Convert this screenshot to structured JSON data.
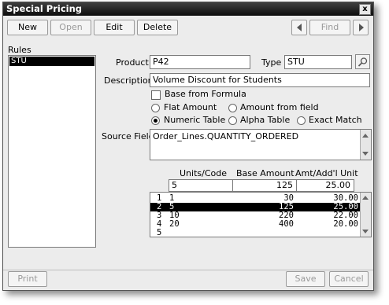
{
  "window": {
    "title": "Special Pricing",
    "close_glyph": "x"
  },
  "toolbar": {
    "new_label": "New",
    "open_label": "Open",
    "edit_label": "Edit",
    "delete_label": "Delete",
    "find_label": "Find",
    "prev_icon": "left-arrow-icon",
    "next_icon": "right-arrow-icon"
  },
  "rules": {
    "label": "Rules",
    "items": [
      "STU"
    ]
  },
  "form": {
    "product_label": "Product",
    "product_value": "P42",
    "type_label": "Type",
    "type_value": "STU",
    "description_label": "Description",
    "description_value": "Volume Discount for Students",
    "base_from_formula_label": "Base from Formula",
    "flat_amount_label": "Flat Amount",
    "amount_from_field_label": "Amount from field",
    "numeric_table_label": "Numeric Table",
    "alpha_table_label": "Alpha Table",
    "exact_match_label": "Exact Match",
    "selected_option": "Numeric Table",
    "source_field_label": "Source Field",
    "source_field_value": "Order_Lines.QUANTITY_ORDERED"
  },
  "table": {
    "headers": [
      "Units/Code",
      "Base Amount",
      "Amt/Add'l Unit"
    ],
    "edit_row": [
      "5",
      "125",
      "25.00"
    ],
    "rows": [
      [
        "1",
        "1",
        "30",
        "30.00"
      ],
      [
        "2",
        "5",
        "125",
        "25.00"
      ],
      [
        "3",
        "10",
        "220",
        "22.00"
      ],
      [
        "4",
        "20",
        "400",
        "20.00"
      ],
      [
        "5",
        "",
        "",
        ""
      ]
    ],
    "selected_row": 2
  },
  "footer": {
    "print_label": "Print",
    "save_label": "Save",
    "cancel_label": "Cancel"
  }
}
